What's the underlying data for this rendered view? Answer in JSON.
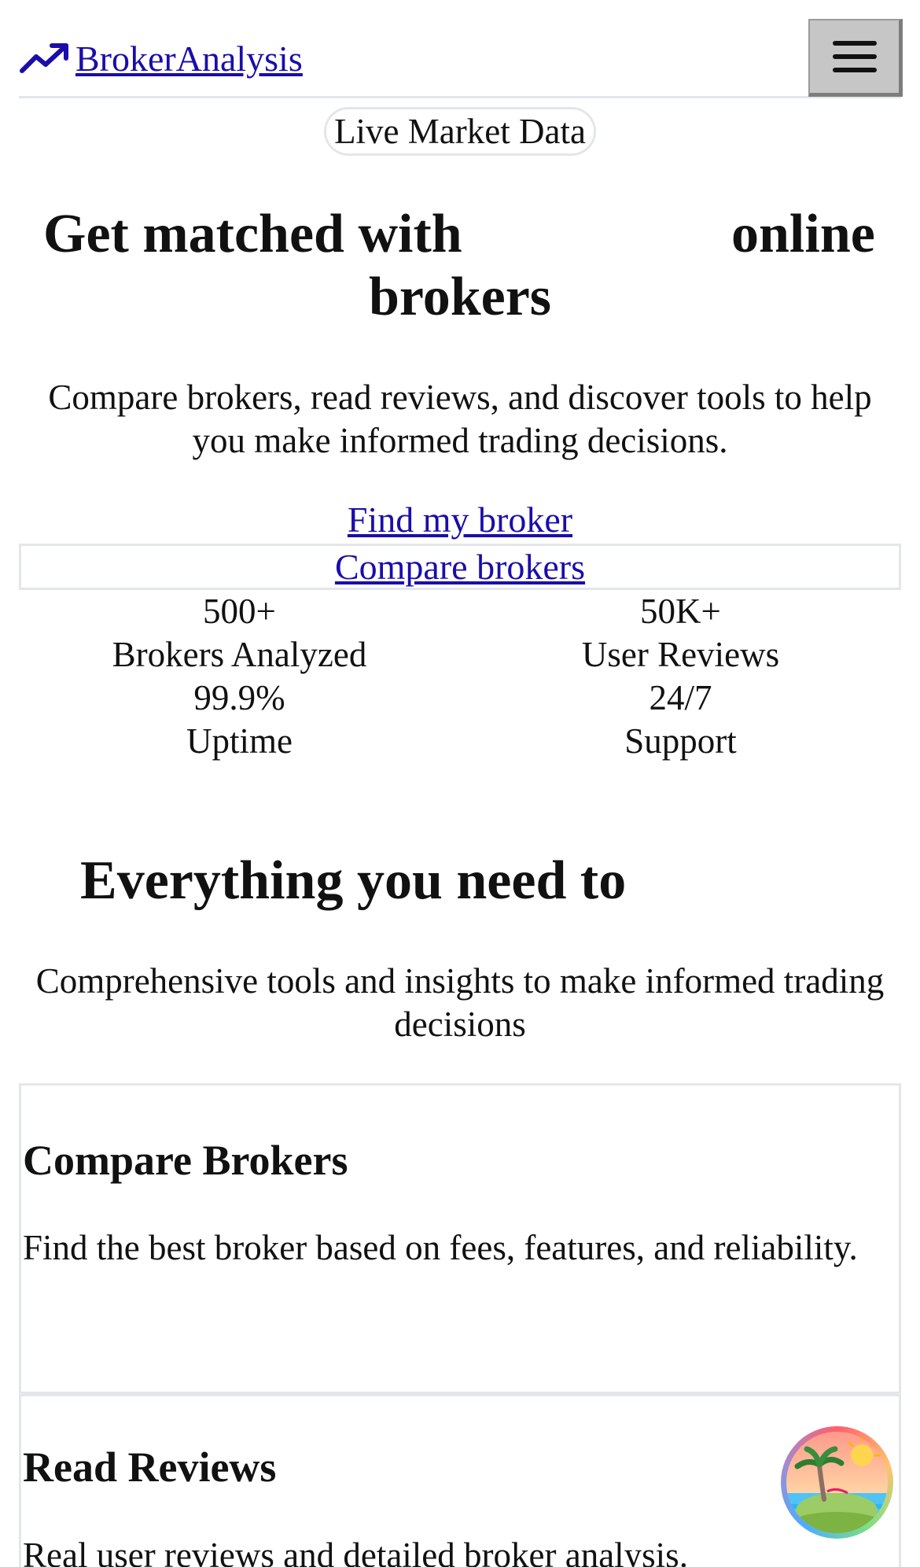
{
  "nav": {
    "logo_icon": "trending-up-icon",
    "brand": "BrokerAnalysis",
    "menu_icon": "hamburger-menu-icon"
  },
  "hero": {
    "badge": "Live Market Data",
    "title_line1_start": "Get matched with",
    "title_line1_end": "online",
    "title_line2": "brokers",
    "subtitle": "Compare brokers, read reviews, and discover tools to help you make informed trading decisions.",
    "primary_link": "Find my broker",
    "secondary_link": "Compare brokers"
  },
  "stats": [
    {
      "value": "500+",
      "label": "Brokers Analyzed"
    },
    {
      "value": "50K+",
      "label": "User Reviews"
    },
    {
      "value": "99.9%",
      "label": "Uptime"
    },
    {
      "value": "24/7",
      "label": "Support"
    }
  ],
  "features": {
    "title": "Everything you need to",
    "subtitle": "Comprehensive tools and insights to make informed trading decisions",
    "cards": [
      {
        "title": "Compare Brokers",
        "text": "Find the best broker based on fees, features, and reliability."
      },
      {
        "title": "Read Reviews",
        "text": "Real user reviews and detailed broker analysis."
      }
    ]
  },
  "floating_button": {
    "icon": "beach-island-icon"
  },
  "colors": {
    "link": "#1a0dab",
    "border": "#e3e6ea",
    "text": "#111111"
  }
}
